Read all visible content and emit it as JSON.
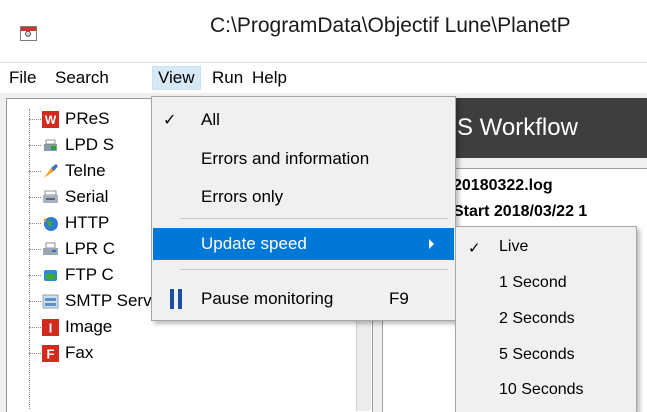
{
  "window": {
    "title": "C:\\ProgramData\\Objectif Lune\\PlanetP"
  },
  "menubar": {
    "items": [
      "File",
      "Search",
      "View",
      "Run",
      "Help"
    ]
  },
  "tree": {
    "items": [
      {
        "label": "PReS",
        "icon": "pres-w-icon"
      },
      {
        "label": "LPD S",
        "icon": "lpd-server-icon"
      },
      {
        "label": "Telne",
        "icon": "telnet-icon"
      },
      {
        "label": "Serial",
        "icon": "serial-icon"
      },
      {
        "label": "HTTP",
        "icon": "http-globe-icon"
      },
      {
        "label": "LPR C",
        "icon": "lpr-printer-icon"
      },
      {
        "label": "FTP C",
        "icon": "ftp-icon"
      },
      {
        "label": "SMTP Server",
        "icon": "smtp-server-icon"
      },
      {
        "label": "Image",
        "icon": "image-icon"
      },
      {
        "label": "Fax",
        "icon": "fax-icon"
      }
    ]
  },
  "workflow": {
    "header": "S Workflow"
  },
  "log": {
    "lines": [
      "20180322.log",
      "Start  2018/03/22 1"
    ]
  },
  "view_menu": {
    "all": "All",
    "errors_info": "Errors and information",
    "errors_only": "Errors only",
    "update_speed": "Update speed",
    "pause": "Pause monitoring",
    "pause_shortcut": "F9",
    "check": "✓"
  },
  "speed_menu": {
    "items": [
      "Live",
      "1 Second",
      "2 Seconds",
      "5 Seconds",
      "10 Seconds"
    ],
    "selected": "Live"
  },
  "colors": {
    "highlight": "#0078d7",
    "menu_active": "#d7e8f7",
    "workflow_header": "#3e3e3e"
  }
}
